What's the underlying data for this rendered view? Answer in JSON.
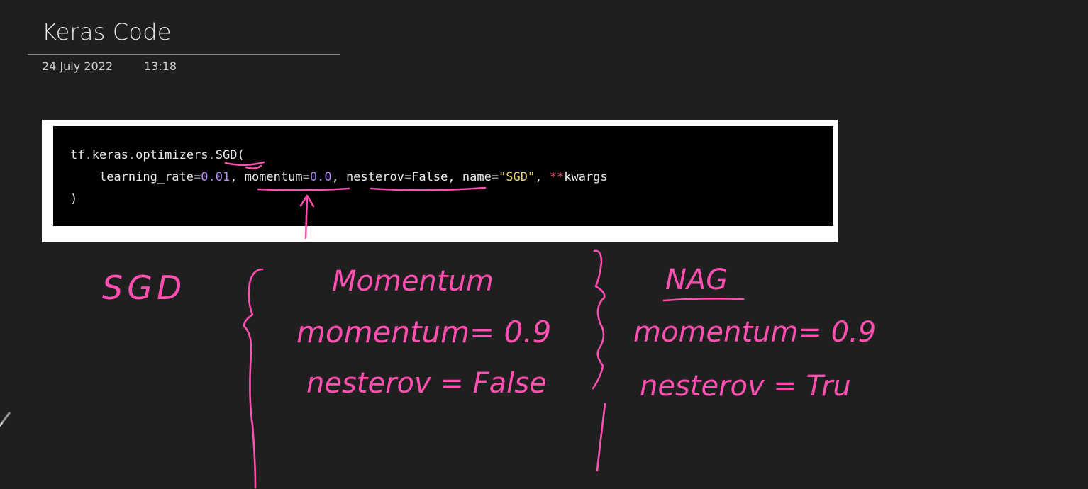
{
  "page": {
    "title": "Keras Code",
    "date": "24 July 2022",
    "time": "13:18"
  },
  "code": {
    "line1": {
      "prefix": "tf",
      "dot1": ".",
      "mod1": "keras",
      "dot2": ".",
      "mod2": "optimizers",
      "dot3": ".",
      "func": "SGD("
    },
    "line2": {
      "indent": "    ",
      "p1": "learning_rate",
      "eq1": "=",
      "v1": "0.01",
      "sep1": ", ",
      "p2": "momentum",
      "eq2": "=",
      "v2": "0.0",
      "sep2": ", ",
      "p3": "nesterov",
      "eq3": "=",
      "v3": "False",
      "sep3": ", ",
      "p4": "name",
      "eq4": "=",
      "v4": "\"SGD\"",
      "sep4": ", ",
      "star": "**",
      "p5": "kwargs"
    },
    "line3": ")"
  },
  "annotations": {
    "sgd": "SGD",
    "momentum_heading": "Momentum",
    "momentum_value": "momentum= 0.9",
    "nesterov_false": "nesterov = False",
    "nag_heading": "NAG",
    "nag_momentum": "momentum= 0.9",
    "nag_nesterov": "nesterov = Tru",
    "ink_color": "#ff4fb0"
  },
  "colors": {
    "background": "#1f1f1f",
    "ink": "#ff4fb0",
    "code_number": "#b28cf5",
    "code_string": "#e6d36b",
    "code_operator": "#ff4f6b"
  },
  "icons": {
    "pen": "pen-icon"
  }
}
